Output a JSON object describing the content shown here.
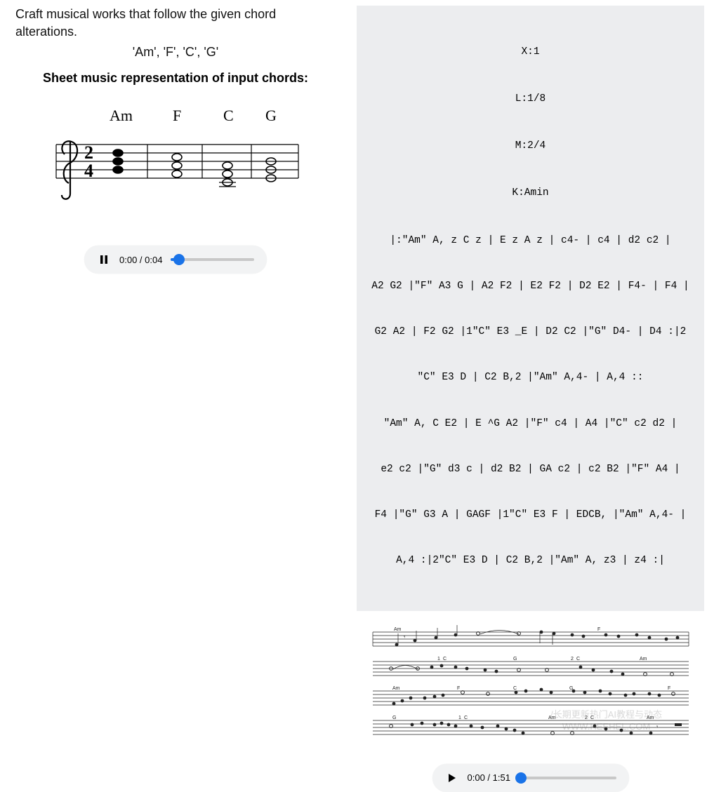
{
  "prompt": "Craft musical works that follow the given chord alterations.",
  "chords_input": "'Am', 'F', 'C', 'G'",
  "sheet_heading": "Sheet music representation of input chords:",
  "input_chord_labels": [
    "Am",
    "F",
    "C",
    "G"
  ],
  "time_signature": {
    "top": "2",
    "bottom": "4"
  },
  "abc": {
    "header": [
      "X:1",
      "L:1/8",
      "M:2/4",
      "K:Amin"
    ],
    "body": [
      "|:\"Am\" A, z C z | E z A z | c4- | c4 | d2 c2 |",
      "A2 G2 |\"F\" A3 G | A2 F2 | E2 F2 | D2 E2 | F4- | F4 |",
      "G2 A2 | F2 G2 |1\"C\" E3 _E | D2 C2 |\"G\" D4- | D4 :|2",
      "\"C\" E3 D | C2 B,2 |\"Am\" A,4- | A,4 ::",
      "\"Am\" A, C E2 | E ^G A2 |\"F\" c4 | A4 |\"C\" c2 d2 |",
      "e2 c2 |\"G\" d3 c | d2 B2 | GA c2 | c2 B2 |\"F\" A4 |",
      "F4 |\"G\" G3 A | GAGF |1\"C\" E3 F | EDCB, |\"Am\" A,4- |",
      "A,4 :|2\"C\" E3 D | C2 B,2 |\"Am\" A, z3 | z4 :|"
    ]
  },
  "audio_left": {
    "state": "playing",
    "current": "0:00",
    "duration": "0:04",
    "progress_pct": 10
  },
  "audio_right": {
    "state": "paused",
    "current": "0:00",
    "duration": "1:51",
    "progress_pct": 2
  },
  "output_section_labels": [
    [
      "Am",
      "F"
    ],
    [
      "C",
      "G",
      "C",
      "Am"
    ],
    [
      "Am",
      "F",
      "C",
      "G",
      "F"
    ],
    [
      "G",
      "C",
      "Am",
      "C",
      "Am"
    ]
  ],
  "watermark": {
    "line1": "/长期更新热门AI教程与动态",
    "line2": "WWW.HEEHEL.COM"
  }
}
